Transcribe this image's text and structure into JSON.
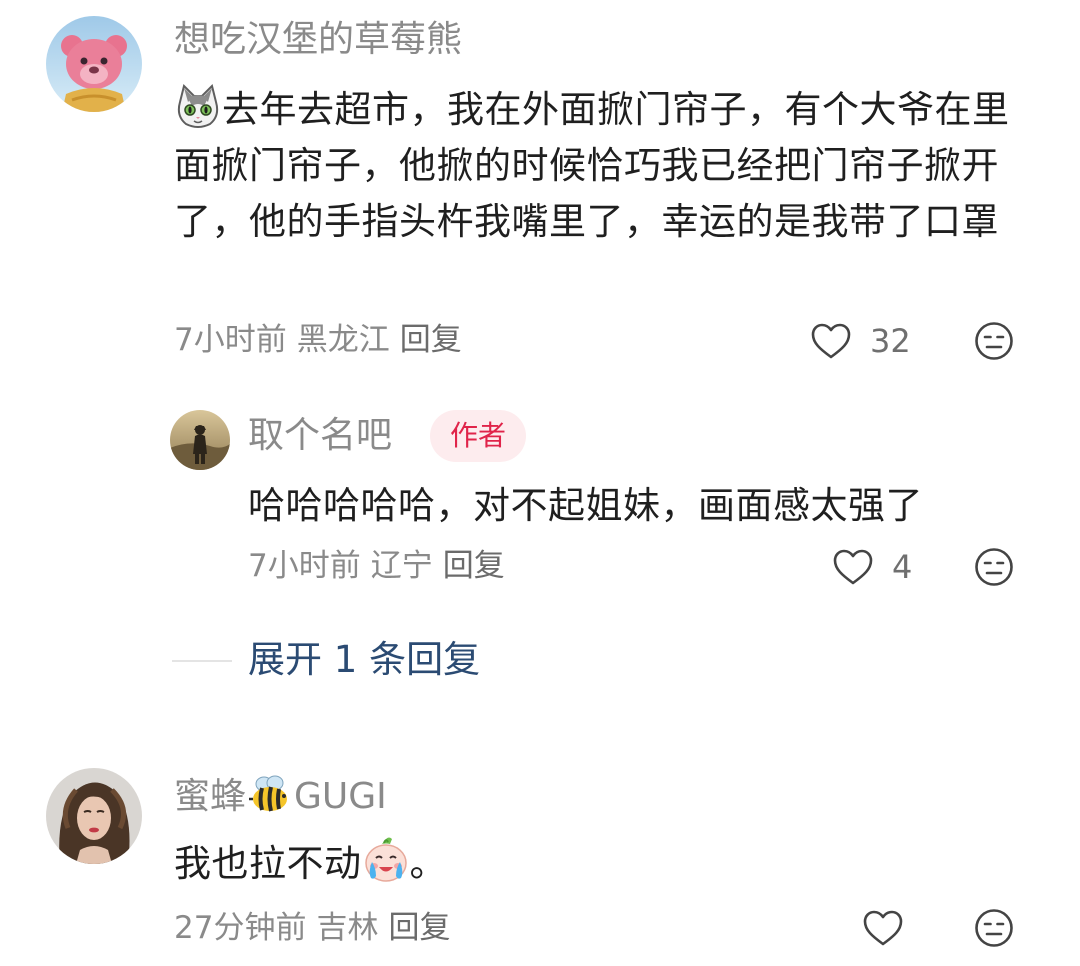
{
  "comments": [
    {
      "username": "想吃汉堡的草莓熊",
      "text": "去年去超市，我在外面掀门帘子，有个大爷在里面掀门帘子，他掀的时候恰巧我已经把门帘子掀开了，他的手指头杵我嘴里了，幸运的是我带了口罩",
      "leading_emoji": "cat-emoji",
      "time": "7小时前",
      "location": "黑龙江",
      "reply_label": "回复",
      "likes": "32",
      "avatar": "strawberry-bear-avatar"
    },
    {
      "username": "蜜蜂",
      "username_emoji": "bee-emoji",
      "username_suffix": "GUGI",
      "text": "我也拉不动",
      "trailing_emoji": "crying-face-emoji",
      "trailing_punct": "。",
      "time": "27分钟前",
      "location": "吉林",
      "reply_label": "回复",
      "likes": "",
      "avatar": "woman-portrait-avatar"
    }
  ],
  "reply": {
    "username": "取个名吧",
    "badge": "作者",
    "text": "哈哈哈哈哈，对不起姐妹，画面感太强了",
    "time": "7小时前",
    "location": "辽宁",
    "reply_label": "回复",
    "likes": "4",
    "avatar": "desert-figure-avatar"
  },
  "expand_replies_label": "展开 1 条回复",
  "colors": {
    "text_primary": "#1f1f1f",
    "text_secondary": "#8a8a8a",
    "badge_bg": "#fdecee",
    "badge_text": "#e0244a",
    "expand_link": "#2b4b73"
  }
}
